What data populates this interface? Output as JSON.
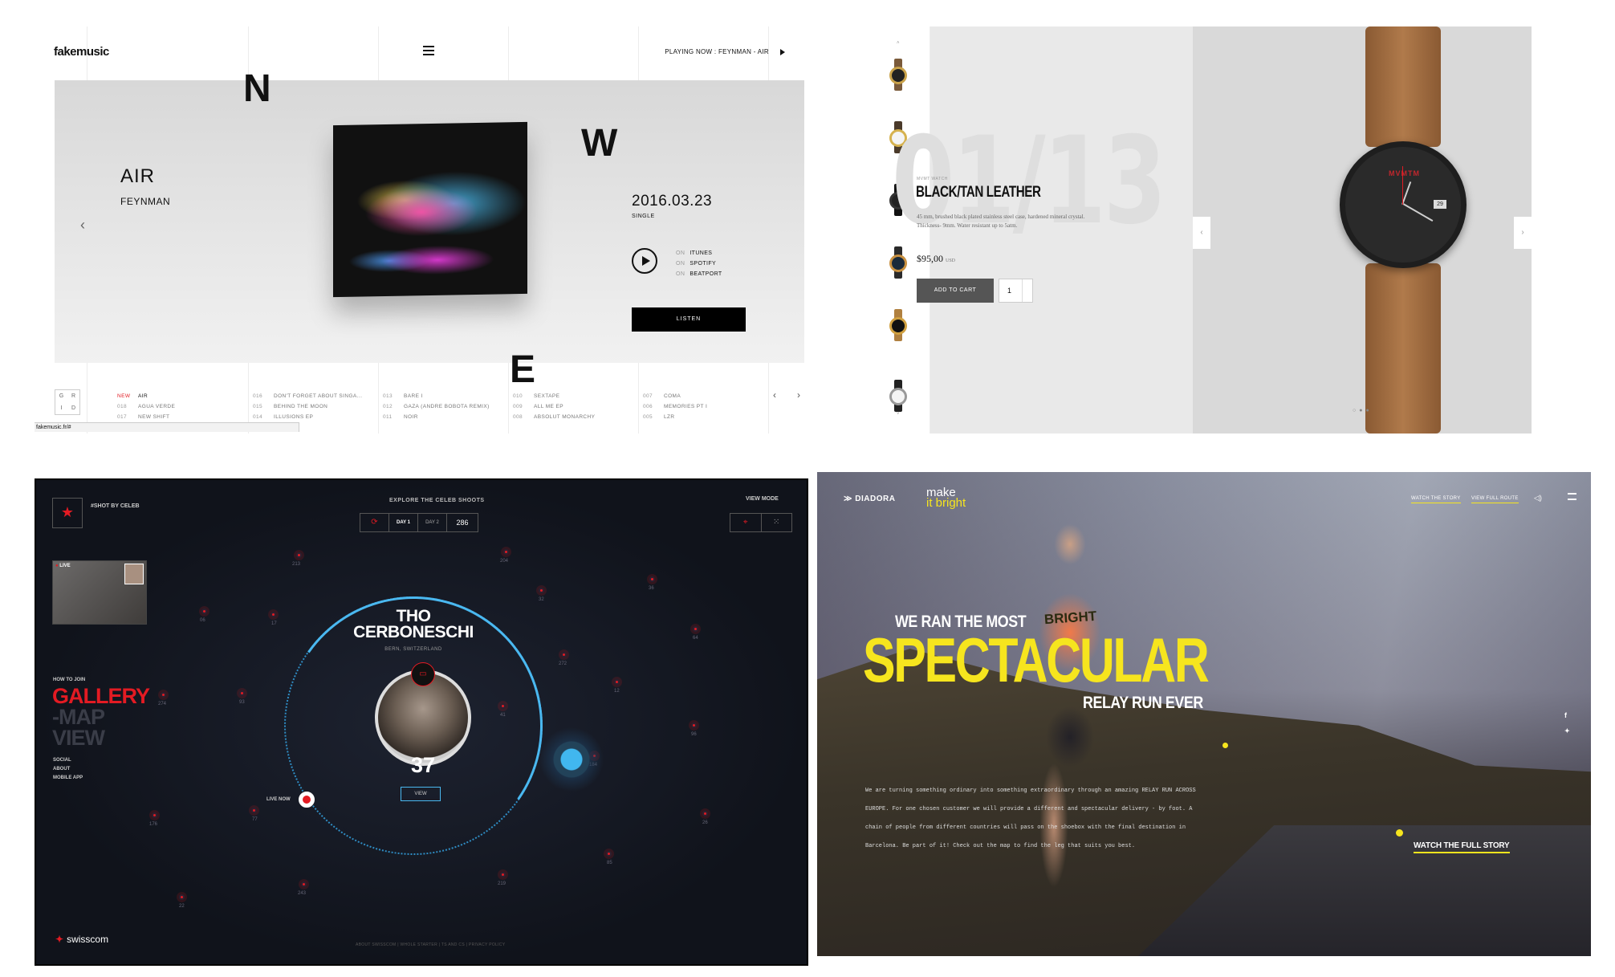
{
  "panel1": {
    "logo": "fakemusic",
    "playing_now": "PLAYING NOW : FEYNMAN - AIR",
    "letters": [
      "N",
      "W",
      "E"
    ],
    "title": "AIR",
    "artist": "FEYNMAN",
    "date": "2016.03.23",
    "release_type": "SINGLE",
    "stores": [
      {
        "on": "ON",
        "name": "ITUNES"
      },
      {
        "on": "ON",
        "name": "SPOTIFY"
      },
      {
        "on": "ON",
        "name": "BEATPORT"
      }
    ],
    "listen_label": "LISTEN",
    "grid_letters": [
      "G",
      "R",
      "I",
      "D"
    ],
    "track_columns": [
      [
        {
          "n": "NEW",
          "t": "AIR"
        },
        {
          "n": "018",
          "t": "AGUA VERDE"
        },
        {
          "n": "017",
          "t": "NEW SHIFT"
        }
      ],
      [
        {
          "n": "016",
          "t": "DON'T FORGET ABOUT SINGA..."
        },
        {
          "n": "015",
          "t": "BEHIND THE MOON"
        },
        {
          "n": "014",
          "t": "ILLUSIONS EP"
        }
      ],
      [
        {
          "n": "013",
          "t": "BARE I"
        },
        {
          "n": "012",
          "t": "GAZA (ANDRE BOBOTA REMIX)"
        },
        {
          "n": "011",
          "t": "NOIR"
        }
      ],
      [
        {
          "n": "010",
          "t": "SEXTAPE"
        },
        {
          "n": "009",
          "t": "ALL ME EP"
        },
        {
          "n": "008",
          "t": "ABSOLUT MONARCHY"
        }
      ],
      [
        {
          "n": "007",
          "t": "COMA"
        },
        {
          "n": "006",
          "t": "MEMORIES PT I"
        },
        {
          "n": "005",
          "t": "LZR"
        }
      ]
    ],
    "status_url": "fakemusic.fr/#"
  },
  "panel2": {
    "counter": "01/13",
    "subtitle": "MVMT WATCH",
    "product_name": "BLACK/TAN LEATHER",
    "description": "45 mm, brushed black plated stainless steel case, hardened mineral crystal. Thickness- 9mm. Water resistant up to 5atm.",
    "price": "$95,00",
    "currency": "USD",
    "add_to_cart": "ADD TO CART",
    "quantity": "1",
    "watch_brand": "MVMTM",
    "date_window": "29"
  },
  "panel3": {
    "shot_label": "#SHOT BY CELEB",
    "explore": "EXPLORE THE CELEB SHOOTS",
    "day1": "DAY 1",
    "day2": "DAY 2",
    "counter": "286",
    "view_mode": "VIEW MODE",
    "live": "LIVE",
    "celeb_first": "THO",
    "celeb_last": "CERBONESCHI",
    "location": "BERN, SWITZERLAND",
    "shots": "37",
    "view_label": "VIEW",
    "live_now": "LIVE NOW",
    "how_to_join": "HOW TO JOIN",
    "gallery": "GALLERY",
    "map": "-MAP",
    "view_word": "VIEW",
    "links": [
      "SOCIAL",
      "ABOUT",
      "MOBILE APP"
    ],
    "brand": "swisscom",
    "footer": "ABOUT SWISSCOM | WHOLE STARTER | TS AND CS | PRIVACY POLICY",
    "pins": [
      "213",
      "204",
      "36",
      "06",
      "17",
      "32",
      "64",
      "272",
      "274",
      "93",
      "41",
      "12",
      "96",
      "77",
      "184",
      "176",
      "26",
      "22",
      "243",
      "219",
      "85"
    ]
  },
  "panel4": {
    "logo": "DIADORA",
    "make": "make",
    "it_bright": "it bright",
    "watch_story_nav": "WATCH THE STORY",
    "view_route_nav": "VIEW FULL ROUTE",
    "we_ran": "WE RAN THE MOST",
    "spectacular": "SPECTACULAR",
    "relay": "RELAY RUN EVER",
    "bright_delivery": "BRIGHT",
    "body": "We are turning something ordinary into something extraordinary through an amazing RELAY RUN ACROSS EUROPE. For one chosen customer we will provide a different and spectacular delivery - by foot. A chain of people from different countries will pass on the shoebox with the final destination in Barcelona. Be part of it! Check out the map to find the leg that suits you best.",
    "watch_full": "WATCH THE FULL STORY",
    "accent": "#f6e51e"
  }
}
